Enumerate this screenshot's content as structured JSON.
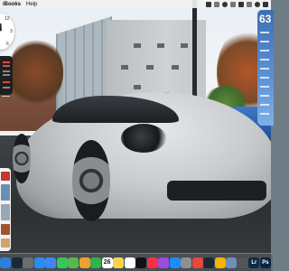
{
  "menubar": {
    "app_name": "iBooks",
    "menu_help": "Help",
    "status_icons": [
      "wifi-icon",
      "battery-icon",
      "search-icon",
      "control-center-icon",
      "screen-icon",
      "bluetooth-icon",
      "siri-icon",
      "notification-icon"
    ]
  },
  "weather": {
    "temperature": "63"
  },
  "clock": {
    "hours": 11,
    "minutes": 50
  },
  "dock": {
    "items": [
      {
        "name": "finder",
        "color": "#2f7de1",
        "label": ""
      },
      {
        "name": "steam",
        "color": "#1b2838",
        "label": ""
      },
      {
        "name": "launchpad",
        "color": "#6d6d6d",
        "label": ""
      },
      {
        "name": "safari",
        "color": "#2a8cf0",
        "label": ""
      },
      {
        "name": "mail",
        "color": "#3b89f5",
        "label": ""
      },
      {
        "name": "messages",
        "color": "#34c759",
        "label": ""
      },
      {
        "name": "maps",
        "color": "#58b84a",
        "label": ""
      },
      {
        "name": "photos",
        "color": "#f0a030",
        "label": ""
      },
      {
        "name": "facetime",
        "color": "#2fb34a",
        "label": ""
      },
      {
        "name": "calendar",
        "color": "#ffffff",
        "label": "26"
      },
      {
        "name": "notes",
        "color": "#f7d44a",
        "label": ""
      },
      {
        "name": "reminders",
        "color": "#ffffff",
        "label": ""
      },
      {
        "name": "tv",
        "color": "#111111",
        "label": ""
      },
      {
        "name": "music",
        "color": "#fa2d48",
        "label": ""
      },
      {
        "name": "podcasts",
        "color": "#9b4de0",
        "label": ""
      },
      {
        "name": "app-store",
        "color": "#1d8cf8",
        "label": ""
      },
      {
        "name": "system-preferences",
        "color": "#8e8e93",
        "label": ""
      },
      {
        "name": "chrome",
        "color": "#e9473b",
        "label": ""
      },
      {
        "name": "steam-2",
        "color": "#1b2838",
        "label": ""
      },
      {
        "name": "tips",
        "color": "#f5b400",
        "label": ""
      },
      {
        "name": "preview",
        "color": "#6d8fb8",
        "label": ""
      },
      {
        "name": "utilities",
        "color": "#555555",
        "label": ""
      },
      {
        "name": "lightroom",
        "color": "#0b2b44",
        "label": "Lr"
      },
      {
        "name": "photoshop",
        "color": "#0b2540",
        "label": "Ps"
      }
    ]
  }
}
